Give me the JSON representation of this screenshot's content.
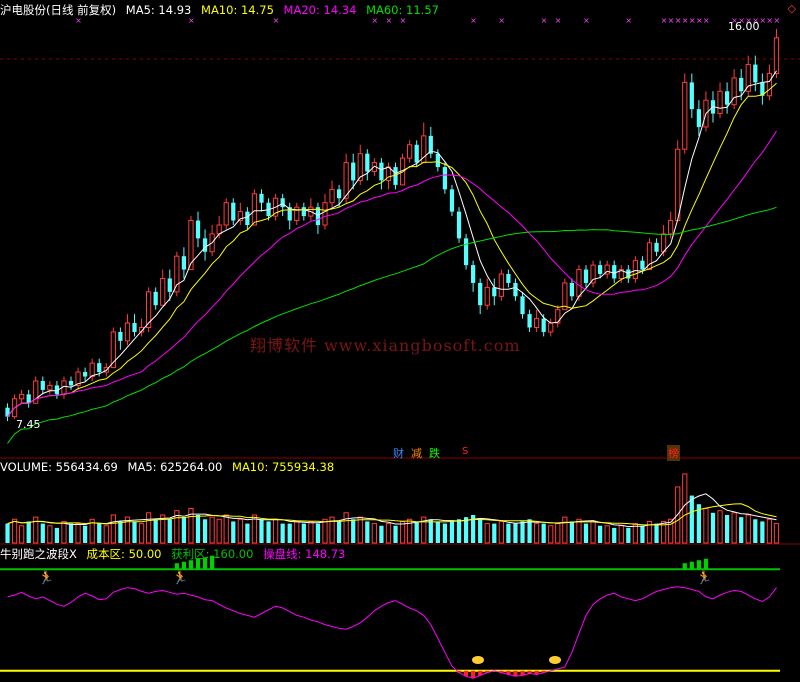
{
  "main_header": {
    "title": "沪电股份(日线 前复权)",
    "ma5": "MA5: 14.93",
    "ma10": "MA10: 14.75",
    "ma20": "MA20: 14.34",
    "ma60": "MA60: 11.57"
  },
  "volume_header": {
    "volume": "VOLUME: 556434.69",
    "ma5": "MA5: 625264.00",
    "ma10": "MA10: 755934.38"
  },
  "indicator_header": {
    "title": "牛别跑之波段X",
    "cost": "成本区: 50.00",
    "profit": "获利区: 160.00",
    "line": "操盘线: 148.73"
  },
  "price_labels": {
    "low": "7.45",
    "high": "16.00"
  },
  "event_tags": {
    "cai": "财",
    "jian": "减",
    "die": "跌",
    "s_mark": "S",
    "bang": "榜"
  },
  "watermark": "翔博软件 www.xiangbosoft.com",
  "colors": {
    "up": "#ff3c3c",
    "down": "#54ffff",
    "ma5": "#ffffff",
    "ma10": "#ffff00",
    "ma20": "#ff00ff",
    "ma60": "#00e000",
    "cost_line": "#00c000",
    "profit_line": "#ffff00",
    "separator": "#8c0000"
  },
  "chart_data": {
    "type": "candlestick",
    "candles": [
      [
        7.7,
        7.5,
        7.8,
        7.4
      ],
      [
        7.5,
        7.9,
        8.0,
        7.45
      ],
      [
        7.9,
        8.0,
        8.1,
        7.8
      ],
      [
        8.0,
        7.8,
        8.1,
        7.7
      ],
      [
        7.8,
        8.3,
        8.4,
        7.8
      ],
      [
        8.3,
        8.1,
        8.4,
        8.0
      ],
      [
        8.1,
        8.2,
        8.3,
        8.0
      ],
      [
        8.2,
        8.0,
        8.3,
        7.9
      ],
      [
        8.0,
        8.3,
        8.4,
        7.9
      ],
      [
        8.3,
        8.2,
        8.4,
        8.1
      ],
      [
        8.2,
        8.5,
        8.6,
        8.1
      ],
      [
        8.5,
        8.4,
        8.6,
        8.3
      ],
      [
        8.4,
        8.7,
        8.8,
        8.3
      ],
      [
        8.7,
        8.5,
        8.8,
        8.4
      ],
      [
        8.5,
        8.6,
        8.7,
        8.4
      ],
      [
        8.6,
        9.4,
        9.5,
        8.6
      ],
      [
        9.4,
        9.2,
        9.5,
        9.0
      ],
      [
        9.2,
        9.6,
        9.8,
        9.1
      ],
      [
        9.6,
        9.4,
        9.8,
        9.3
      ],
      [
        9.4,
        9.5,
        9.7,
        9.3
      ],
      [
        9.5,
        10.3,
        10.4,
        9.4
      ],
      [
        10.3,
        10.0,
        10.4,
        9.9
      ],
      [
        10.0,
        10.6,
        10.8,
        10.0
      ],
      [
        10.6,
        10.3,
        10.8,
        10.1
      ],
      [
        10.3,
        11.1,
        11.2,
        10.2
      ],
      [
        11.1,
        10.8,
        11.3,
        10.6
      ],
      [
        10.8,
        11.9,
        12.0,
        10.8
      ],
      [
        11.9,
        11.5,
        12.1,
        11.3
      ],
      [
        11.5,
        11.2,
        11.7,
        11.0
      ],
      [
        11.2,
        11.6,
        11.8,
        11.1
      ],
      [
        11.6,
        11.8,
        12.0,
        11.5
      ],
      [
        11.8,
        12.3,
        12.4,
        11.7
      ],
      [
        12.3,
        11.9,
        12.4,
        11.8
      ],
      [
        11.9,
        12.1,
        12.3,
        11.8
      ],
      [
        12.1,
        11.8,
        12.2,
        11.7
      ],
      [
        11.8,
        12.5,
        12.6,
        11.8
      ],
      [
        12.5,
        12.3,
        12.6,
        12.1
      ],
      [
        12.3,
        12.0,
        12.4,
        11.9
      ],
      [
        12.0,
        12.4,
        12.5,
        11.9
      ],
      [
        12.4,
        12.2,
        12.5,
        12.0
      ],
      [
        12.2,
        11.9,
        12.3,
        11.7
      ],
      [
        11.9,
        12.2,
        12.3,
        11.8
      ],
      [
        12.2,
        12.0,
        12.3,
        11.9
      ],
      [
        12.0,
        12.2,
        12.4,
        11.9
      ],
      [
        12.2,
        11.8,
        12.3,
        11.6
      ],
      [
        11.8,
        12.3,
        12.5,
        11.7
      ],
      [
        12.3,
        12.6,
        12.8,
        12.2
      ],
      [
        12.6,
        12.4,
        12.7,
        12.2
      ],
      [
        12.4,
        13.2,
        13.4,
        12.3
      ],
      [
        13.2,
        12.8,
        13.4,
        12.6
      ],
      [
        12.8,
        13.4,
        13.6,
        12.7
      ],
      [
        13.4,
        13.0,
        13.5,
        12.8
      ],
      [
        13.0,
        13.2,
        13.3,
        12.9
      ],
      [
        13.2,
        12.8,
        13.3,
        12.6
      ],
      [
        12.8,
        13.1,
        13.2,
        12.6
      ],
      [
        13.1,
        12.7,
        13.2,
        12.6
      ],
      [
        12.7,
        13.3,
        13.4,
        12.7
      ],
      [
        13.3,
        13.6,
        13.7,
        13.2
      ],
      [
        13.6,
        13.2,
        13.7,
        13.1
      ],
      [
        13.2,
        13.8,
        14.1,
        13.2
      ],
      [
        13.8,
        13.4,
        14.0,
        13.3
      ],
      [
        13.4,
        13.1,
        13.5,
        13.0
      ],
      [
        13.1,
        12.6,
        13.2,
        12.5
      ],
      [
        12.6,
        12.1,
        12.7,
        12.0
      ],
      [
        12.1,
        11.5,
        12.2,
        11.4
      ],
      [
        11.5,
        10.9,
        11.6,
        10.8
      ],
      [
        10.9,
        10.5,
        11.0,
        10.3
      ],
      [
        10.5,
        10.0,
        10.6,
        9.8
      ],
      [
        10.0,
        10.4,
        10.6,
        9.9
      ],
      [
        10.4,
        10.2,
        10.6,
        10.0
      ],
      [
        10.2,
        10.7,
        10.8,
        10.1
      ],
      [
        10.7,
        10.5,
        10.8,
        10.4
      ],
      [
        10.5,
        10.2,
        10.6,
        10.1
      ],
      [
        10.2,
        9.8,
        10.3,
        9.7
      ],
      [
        9.8,
        9.5,
        9.9,
        9.4
      ],
      [
        9.5,
        9.7,
        9.9,
        9.4
      ],
      [
        9.7,
        9.4,
        9.8,
        9.3
      ],
      [
        9.4,
        9.6,
        9.7,
        9.3
      ],
      [
        9.6,
        9.9,
        10.0,
        9.5
      ],
      [
        9.9,
        10.5,
        10.6,
        9.9
      ],
      [
        10.5,
        10.2,
        10.6,
        10.1
      ],
      [
        10.2,
        10.8,
        10.9,
        10.1
      ],
      [
        10.8,
        10.5,
        10.9,
        10.4
      ],
      [
        10.5,
        10.9,
        11.0,
        10.4
      ],
      [
        10.9,
        10.7,
        11.0,
        10.6
      ],
      [
        10.7,
        10.9,
        11.0,
        10.6
      ],
      [
        10.9,
        10.6,
        11.0,
        10.5
      ],
      [
        10.6,
        10.8,
        10.9,
        10.5
      ],
      [
        10.8,
        10.6,
        10.9,
        10.5
      ],
      [
        10.6,
        11.0,
        11.1,
        10.5
      ],
      [
        11.0,
        10.8,
        11.1,
        10.7
      ],
      [
        10.8,
        11.4,
        11.5,
        10.8
      ],
      [
        11.4,
        11.2,
        11.5,
        11.1
      ],
      [
        11.2,
        11.6,
        11.8,
        11.1
      ],
      [
        11.6,
        11.9,
        12.1,
        11.5
      ],
      [
        11.9,
        13.5,
        13.7,
        11.9
      ],
      [
        13.5,
        15.0,
        15.2,
        13.4
      ],
      [
        15.0,
        14.4,
        15.2,
        14.2
      ],
      [
        14.4,
        14.0,
        14.6,
        13.8
      ],
      [
        14.0,
        14.6,
        14.8,
        13.9
      ],
      [
        14.6,
        14.3,
        14.8,
        14.1
      ],
      [
        14.3,
        14.8,
        15.0,
        14.2
      ],
      [
        14.8,
        14.5,
        15.0,
        14.3
      ],
      [
        14.5,
        15.1,
        15.3,
        14.4
      ],
      [
        15.1,
        14.8,
        15.3,
        14.6
      ],
      [
        14.8,
        15.4,
        15.6,
        14.7
      ],
      [
        15.4,
        15.0,
        15.6,
        14.8
      ],
      [
        15.0,
        14.7,
        15.2,
        14.5
      ],
      [
        14.7,
        15.2,
        15.4,
        14.6
      ],
      [
        15.2,
        16.0,
        16.2,
        15.1
      ]
    ],
    "y_range": [
      7.2,
      16.4
    ],
    "volume": [
      0.9,
      1.1,
      0.8,
      1.0,
      1.2,
      0.9,
      0.8,
      0.7,
      1.0,
      0.9,
      0.9,
      0.8,
      1.1,
      0.9,
      0.8,
      1.3,
      1.0,
      1.2,
      1.0,
      0.9,
      1.4,
      1.1,
      1.3,
      1.1,
      1.5,
      1.2,
      1.6,
      1.3,
      1.1,
      1.2,
      1.1,
      1.3,
      1.0,
      1.1,
      0.9,
      1.3,
      1.1,
      1.0,
      1.1,
      0.9,
      0.9,
      1.0,
      0.9,
      1.0,
      0.9,
      1.1,
      1.2,
      1.0,
      1.4,
      1.1,
      1.2,
      1.0,
      0.9,
      0.8,
      0.9,
      0.8,
      1.0,
      1.1,
      1.0,
      1.2,
      1.1,
      1.0,
      0.9,
      1.0,
      1.1,
      1.2,
      1.3,
      1.1,
      0.9,
      0.9,
      1.0,
      0.9,
      0.9,
      1.0,
      1.1,
      0.9,
      0.9,
      0.8,
      0.9,
      1.2,
      1.0,
      1.1,
      0.9,
      1.0,
      0.8,
      0.8,
      0.7,
      0.8,
      0.7,
      0.9,
      0.8,
      1.0,
      0.9,
      1.0,
      1.1,
      2.6,
      3.2,
      2.2,
      1.8,
      1.6,
      1.4,
      1.5,
      1.3,
      1.4,
      1.2,
      1.3,
      1.1,
      1.0,
      1.1,
      0.9
    ],
    "indicator": [
      130,
      132,
      135,
      131,
      128,
      130,
      126,
      122,
      120,
      124,
      130,
      134,
      131,
      127,
      128,
      135,
      138,
      140,
      139,
      136,
      134,
      136,
      137,
      135,
      133,
      134,
      132,
      130,
      127,
      126,
      122,
      118,
      115,
      112,
      110,
      108,
      112,
      116,
      120,
      118,
      114,
      110,
      108,
      105,
      103,
      100,
      98,
      96,
      95,
      98,
      102,
      108,
      115,
      120,
      124,
      126,
      122,
      118,
      115,
      110,
      100,
      85,
      70,
      55,
      48,
      44,
      42,
      45,
      48,
      50,
      48,
      46,
      44,
      45,
      47,
      46,
      48,
      50,
      52,
      54,
      70,
      90,
      110,
      122,
      128,
      132,
      134,
      130,
      128,
      126,
      128,
      132,
      136,
      138,
      140,
      141,
      140,
      138,
      136,
      130,
      128,
      132,
      135,
      137,
      136,
      132,
      128,
      125,
      130,
      140
    ],
    "indicator_range": [
      40,
      170
    ]
  }
}
